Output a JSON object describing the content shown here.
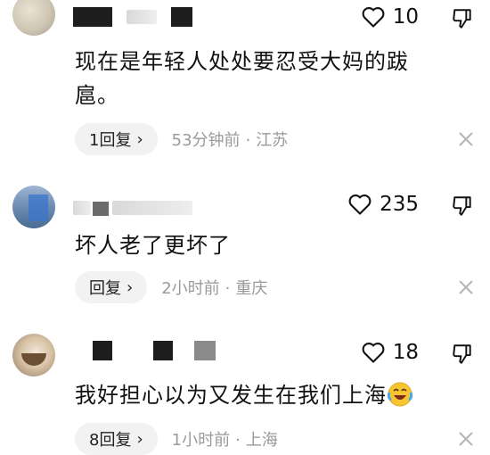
{
  "comments": [
    {
      "text": "现在是年轻人处处要忍受大妈的跋扈。",
      "likes": "10",
      "reply_label": "1回复",
      "time": "53分钟前",
      "location": "江苏",
      "avatar_icon": "avatar-photo",
      "username_obscured": true
    },
    {
      "text": "坏人老了更坏了",
      "likes": "235",
      "reply_label": "回复",
      "time": "2小时前",
      "location": "重庆",
      "avatar_icon": "avatar-photo",
      "username_obscured": true
    },
    {
      "text": "我好担心以为又发生在我们上海",
      "likes": "18",
      "reply_label": "8回复",
      "time": "1小时前",
      "location": "上海",
      "avatar_icon": "avatar-photo",
      "username_obscured": true,
      "emoji": "crying-laughing-emoji"
    }
  ],
  "icons": {
    "like": "heart-icon",
    "dislike": "thumbs-down-icon",
    "expand": "chevron-right-icon",
    "dismiss": "close-icon"
  },
  "separator": "·",
  "chevron": "›"
}
